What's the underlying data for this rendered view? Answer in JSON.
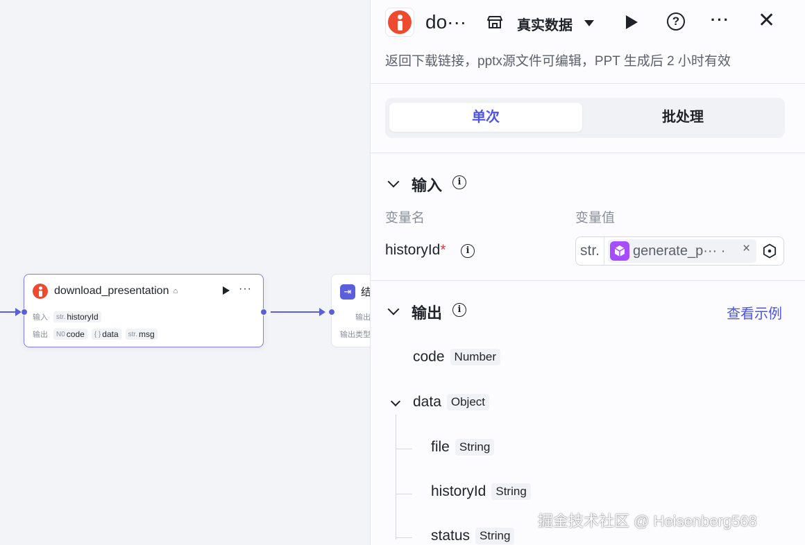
{
  "canvas": {
    "node": {
      "title": "download_presentation",
      "input_label": "输入",
      "output_label": "输出",
      "inputs": [
        {
          "type": "str.",
          "name": "historyId"
        }
      ],
      "outputs": [
        {
          "type": "N0",
          "name": "code"
        },
        {
          "type": "{ }",
          "name": "data"
        },
        {
          "type": "str.",
          "name": "msg"
        }
      ]
    },
    "next_node": {
      "title_partial": "结",
      "output_label_partial": "输出",
      "output_type_label_partial": "输出类型"
    }
  },
  "panel": {
    "title": "do···",
    "data_source": "真实数据",
    "description": "返回下载链接，pptx源文件可编辑，PPT 生成后 2 小时有效",
    "tabs": [
      {
        "label": "单次",
        "active": true
      },
      {
        "label": "批处理",
        "active": false
      }
    ],
    "input_section": {
      "title": "输入",
      "col_name": "变量名",
      "col_value": "变量值",
      "variable": {
        "name": "historyId",
        "required_mark": "*",
        "type_label": "str.",
        "value": "generate_p··· ·",
        "clear": "×"
      }
    },
    "output_section": {
      "title": "输出",
      "see_example": "查看示例",
      "fields": [
        {
          "name": "code",
          "type": "Number"
        },
        {
          "name": "data",
          "type": "Object"
        },
        {
          "name": "file",
          "type": "String"
        },
        {
          "name": "historyId",
          "type": "String"
        },
        {
          "name": "status",
          "type": "String"
        }
      ]
    },
    "watermark": "掘金技术社区 @ Heisenberg568"
  },
  "colors": {
    "accent": "#4d53e8",
    "edge": "#5b5fd9",
    "plugin_logo": "#ee4a2f",
    "chip_icon": "#a64dff"
  },
  "icons": {
    "plugin_logo": "info-i-logo",
    "store": "store-icon",
    "run": "play-icon",
    "help": "question-icon",
    "more": "ellipsis-icon",
    "close": "close-icon",
    "collapse": "chevron-down-icon",
    "info": "info-icon",
    "reference": "variable-reference-icon"
  }
}
